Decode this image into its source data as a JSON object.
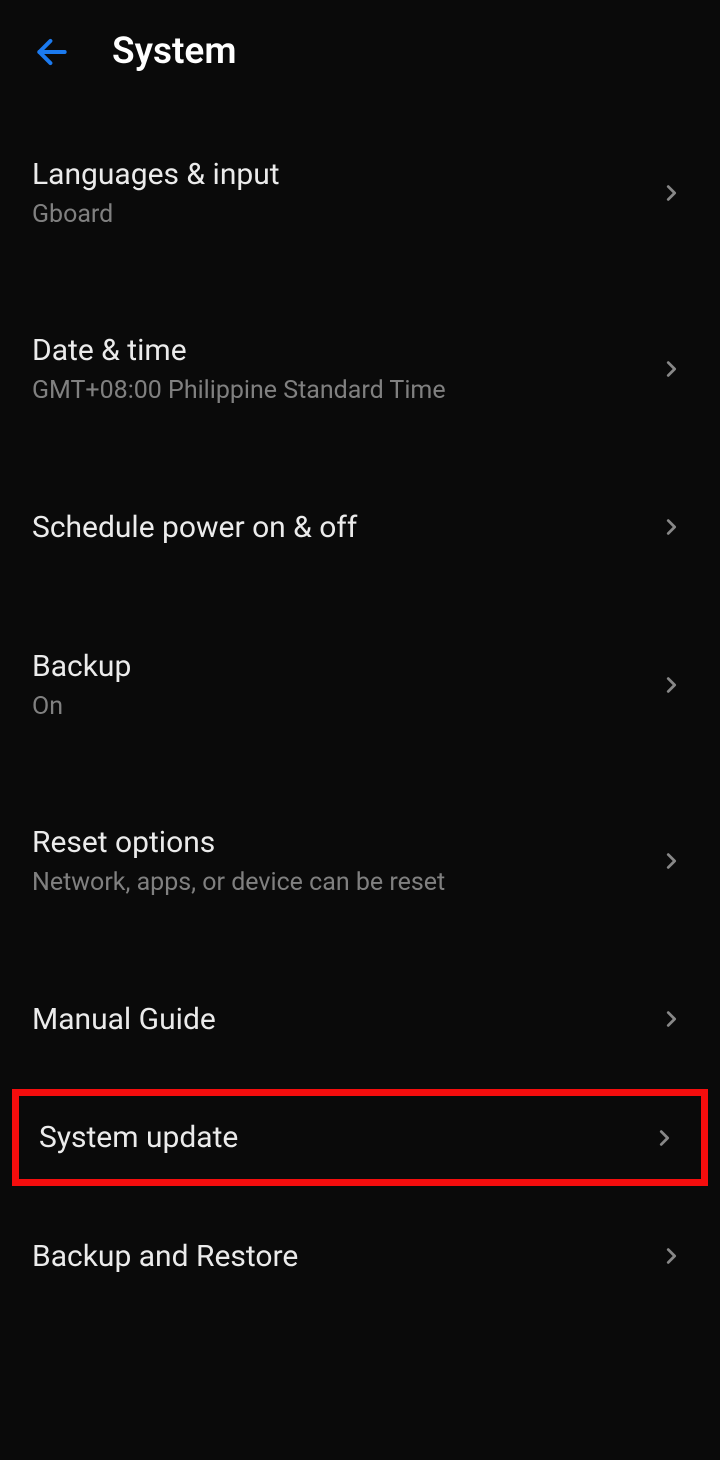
{
  "header": {
    "title": "System"
  },
  "items": [
    {
      "id": "languages",
      "label": "Languages & input",
      "subtitle": "Gboard"
    },
    {
      "id": "datetime",
      "label": "Date & time",
      "subtitle": "GMT+08:00 Philippine Standard Time"
    },
    {
      "id": "schedule-power",
      "label": "Schedule power on & off",
      "subtitle": null
    },
    {
      "id": "backup",
      "label": "Backup",
      "subtitle": "On"
    },
    {
      "id": "reset",
      "label": "Reset options",
      "subtitle": "Network, apps, or device can be reset"
    },
    {
      "id": "manual-guide",
      "label": "Manual Guide",
      "subtitle": null
    },
    {
      "id": "system-update",
      "label": "System update",
      "subtitle": null,
      "highlighted": true
    },
    {
      "id": "backup-restore",
      "label": "Backup and Restore",
      "subtitle": null
    }
  ]
}
